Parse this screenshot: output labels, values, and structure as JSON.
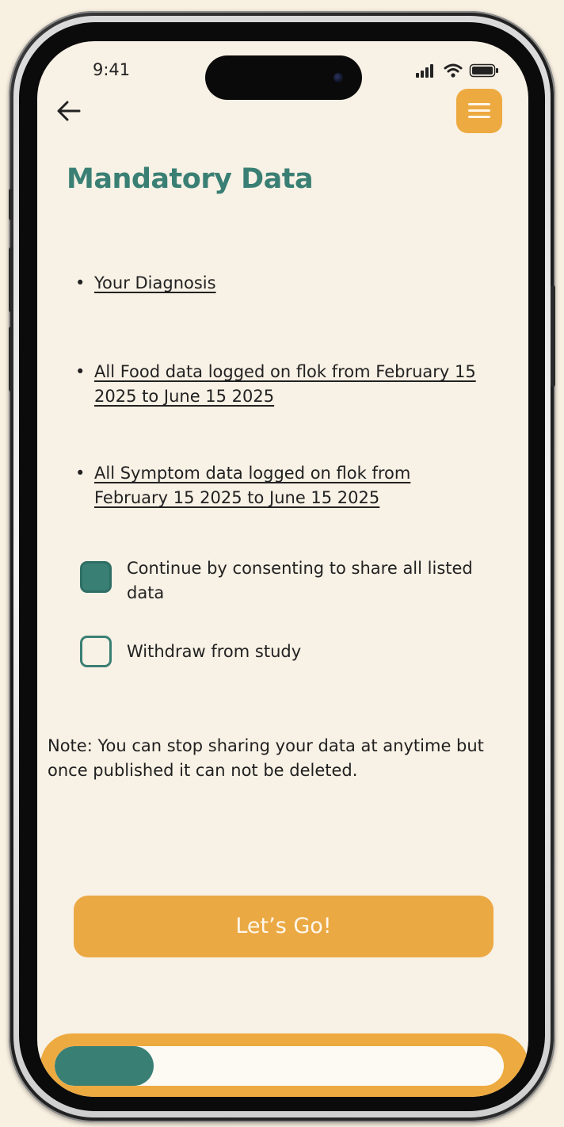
{
  "status_bar": {
    "time": "9:41"
  },
  "header": {
    "back_icon": "arrow-left-icon",
    "menu_icon": "hamburger-menu-icon"
  },
  "page": {
    "title": "Mandatory Data"
  },
  "data_items": [
    {
      "label": "Your Diagnosis"
    },
    {
      "label": "All Food data logged on flok from February 15 2025 to June 15 2025"
    },
    {
      "label": "All Symptom data logged on flok from February 15 2025 to June 15 2025"
    }
  ],
  "options": [
    {
      "label": "Continue by consenting to share all listed data",
      "checked": true
    },
    {
      "label": "Withdraw from study",
      "checked": false
    }
  ],
  "note": "Note: You can stop sharing your data at anytime but once published it can not be deleted.",
  "cta": {
    "label": "Let’s Go!"
  },
  "progress": {
    "fraction": 0.22
  },
  "colors": {
    "background": "#F8F1E5",
    "accent_orange": "#EDAA40",
    "accent_teal": "#3A7F74",
    "text": "#222222"
  }
}
